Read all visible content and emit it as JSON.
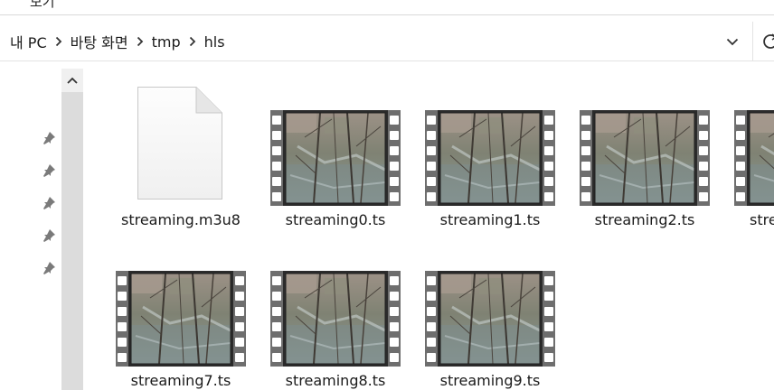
{
  "ribbon": {
    "label": "보기"
  },
  "breadcrumb": {
    "items": [
      "내 PC",
      "바탕 화면",
      "tmp",
      "hls"
    ]
  },
  "files": [
    {
      "name": "streaming.m3u8",
      "kind": "document-icon"
    },
    {
      "name": "streaming0.ts",
      "kind": "video-thumbnail"
    },
    {
      "name": "streaming1.ts",
      "kind": "video-thumbnail"
    },
    {
      "name": "streaming2.ts",
      "kind": "video-thumbnail"
    },
    {
      "name": "stre",
      "kind": "video-thumbnail"
    },
    {
      "name": "streaming7.ts",
      "kind": "video-thumbnail"
    },
    {
      "name": "streaming8.ts",
      "kind": "video-thumbnail"
    },
    {
      "name": "streaming9.ts",
      "kind": "video-thumbnail"
    }
  ],
  "icons": {
    "chevron": "chevron-right-icon",
    "dropdown": "chevron-down-icon",
    "refresh": "refresh-icon",
    "pin": "pin-icon",
    "scroll": "chevron-up-icon"
  },
  "colors": {
    "filmstrip": "#6e6e6e",
    "frame": "#2b2b2b",
    "scrollbar": "#dcdcdc"
  }
}
